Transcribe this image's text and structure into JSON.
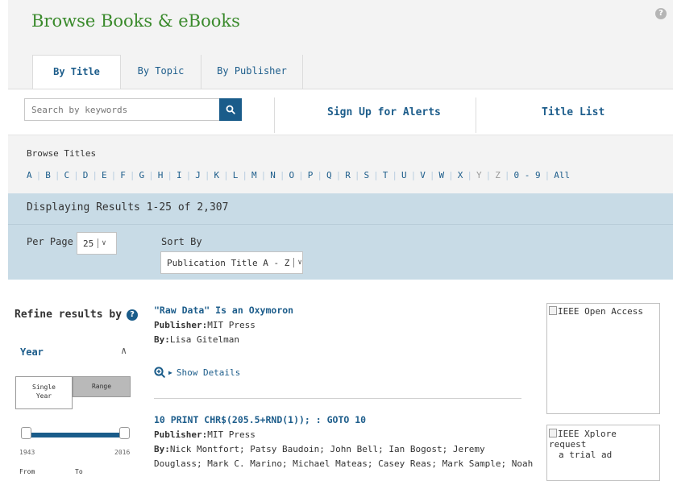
{
  "header": {
    "title": "Browse Books & eBooks"
  },
  "tabs": [
    {
      "label": "By Title",
      "active": true
    },
    {
      "label": "By Topic",
      "active": false
    },
    {
      "label": "By Publisher",
      "active": false
    }
  ],
  "search": {
    "placeholder": "Search by keywords",
    "value": ""
  },
  "links": {
    "alerts": "Sign Up for Alerts",
    "title_list": "Title List"
  },
  "browse": {
    "label": "Browse Titles",
    "letters": [
      {
        "t": "A",
        "on": true
      },
      {
        "t": "B",
        "on": true
      },
      {
        "t": "C",
        "on": true
      },
      {
        "t": "D",
        "on": true
      },
      {
        "t": "E",
        "on": true
      },
      {
        "t": "F",
        "on": true
      },
      {
        "t": "G",
        "on": true
      },
      {
        "t": "H",
        "on": true
      },
      {
        "t": "I",
        "on": true
      },
      {
        "t": "J",
        "on": true
      },
      {
        "t": "K",
        "on": true
      },
      {
        "t": "L",
        "on": true
      },
      {
        "t": "M",
        "on": true
      },
      {
        "t": "N",
        "on": true
      },
      {
        "t": "O",
        "on": true
      },
      {
        "t": "P",
        "on": true
      },
      {
        "t": "Q",
        "on": true
      },
      {
        "t": "R",
        "on": true
      },
      {
        "t": "S",
        "on": true
      },
      {
        "t": "T",
        "on": true
      },
      {
        "t": "U",
        "on": true
      },
      {
        "t": "V",
        "on": true
      },
      {
        "t": "W",
        "on": true
      },
      {
        "t": "X",
        "on": true
      },
      {
        "t": "Y",
        "on": false
      },
      {
        "t": "Z",
        "on": false
      },
      {
        "t": "0 - 9",
        "on": true
      },
      {
        "t": "All",
        "on": true
      }
    ]
  },
  "results": {
    "text": "Displaying Results 1-25 of 2,307"
  },
  "controls": {
    "per_page_label": "Per Page",
    "per_page_value": "25",
    "sort_label": "Sort By",
    "sort_value": "Publication Title A - Z"
  },
  "refine": {
    "label": "Refine results by",
    "year_label": "Year",
    "single": "Single\nYear",
    "range": "Range",
    "min_year": "1943",
    "max_year": "2016",
    "from": "From",
    "to": "To"
  },
  "items": [
    {
      "title": "\"Raw Data\" Is an Oxymoron",
      "publisher_label": "Publisher:",
      "publisher": "MIT Press",
      "by_label": "By:",
      "authors": "Lisa Gitelman",
      "show_details": "Show Details"
    },
    {
      "title": "10 PRINT CHR$(205.5+RND(1)); : GOTO 10",
      "publisher_label": "Publisher:",
      "publisher": "MIT Press",
      "by_label": "By:",
      "authors_line1": "Nick Montfort; Patsy Baudoin; John Bell; Ian Bogost; Jeremy",
      "authors_line2": "Douglass; Mark C. Marino; Michael Mateas; Casey Reas; Mark Sample; Noah"
    }
  ],
  "ads": [
    {
      "alt": "IEEE Open Access"
    },
    {
      "alt_line1": "IEEE Xplore request",
      "alt_line2": "a trial ad"
    }
  ],
  "colors": {
    "brand_green": "#3a8a2c",
    "link_blue": "#1d5d8b",
    "band_blue": "#c8dbe6",
    "button_blue": "#1a5c8a"
  }
}
